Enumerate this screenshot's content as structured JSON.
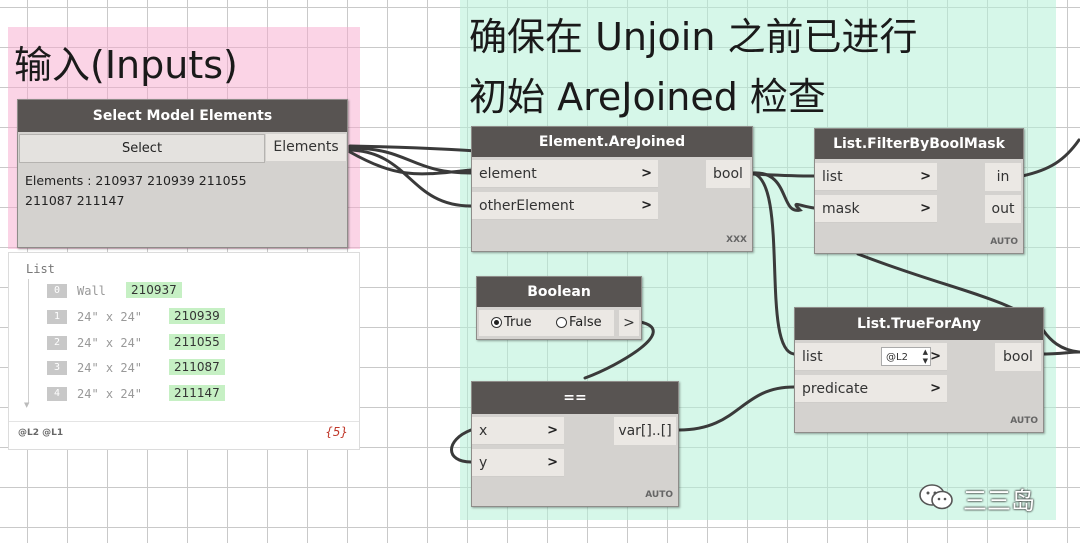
{
  "groups": {
    "inputs_title": "输入(Inputs)",
    "check_title_line1": "确保在 Unjoin 之前已进行",
    "check_title_line2": "初始 AreJoined 检查"
  },
  "select_node": {
    "title": "Select Model Elements",
    "button_label": "Select",
    "output_label": "Elements",
    "info_line1": "Elements : 210937 210939 211055",
    "info_line2": "211087 211147"
  },
  "watch": {
    "header": "List",
    "items": [
      {
        "index": "0",
        "label": "Wall",
        "value": "210937"
      },
      {
        "index": "1",
        "label": "24\" x 24\"",
        "value": "210939"
      },
      {
        "index": "2",
        "label": "24\" x 24\"",
        "value": "211055"
      },
      {
        "index": "3",
        "label": "24\" x 24\"",
        "value": "211087"
      },
      {
        "index": "4",
        "label": "24\" x 24\"",
        "value": "211147"
      }
    ],
    "levels": "@L2 @L1",
    "count": "{5}"
  },
  "arejoined_node": {
    "title": "Element.AreJoined",
    "input1": "element",
    "input2": "otherElement",
    "output": "bool",
    "lacing": "XXX"
  },
  "filter_node": {
    "title": "List.FilterByBoolMask",
    "input1": "list",
    "input2": "mask",
    "output1": "in",
    "output2": "out",
    "lacing": "AUTO"
  },
  "boolean_node": {
    "title": "Boolean",
    "option_true": "True",
    "option_false": "False",
    "selected": "True",
    "output": ">"
  },
  "trueforany_node": {
    "title": "List.TrueForAny",
    "input1": "list",
    "level": "@L2",
    "input2": "predicate",
    "output": "bool",
    "lacing": "AUTO"
  },
  "equals_node": {
    "title": "==",
    "input1": "x",
    "input2": "y",
    "output": "var[]..[]",
    "lacing": "AUTO"
  },
  "watermark": {
    "text": "三三岛"
  }
}
